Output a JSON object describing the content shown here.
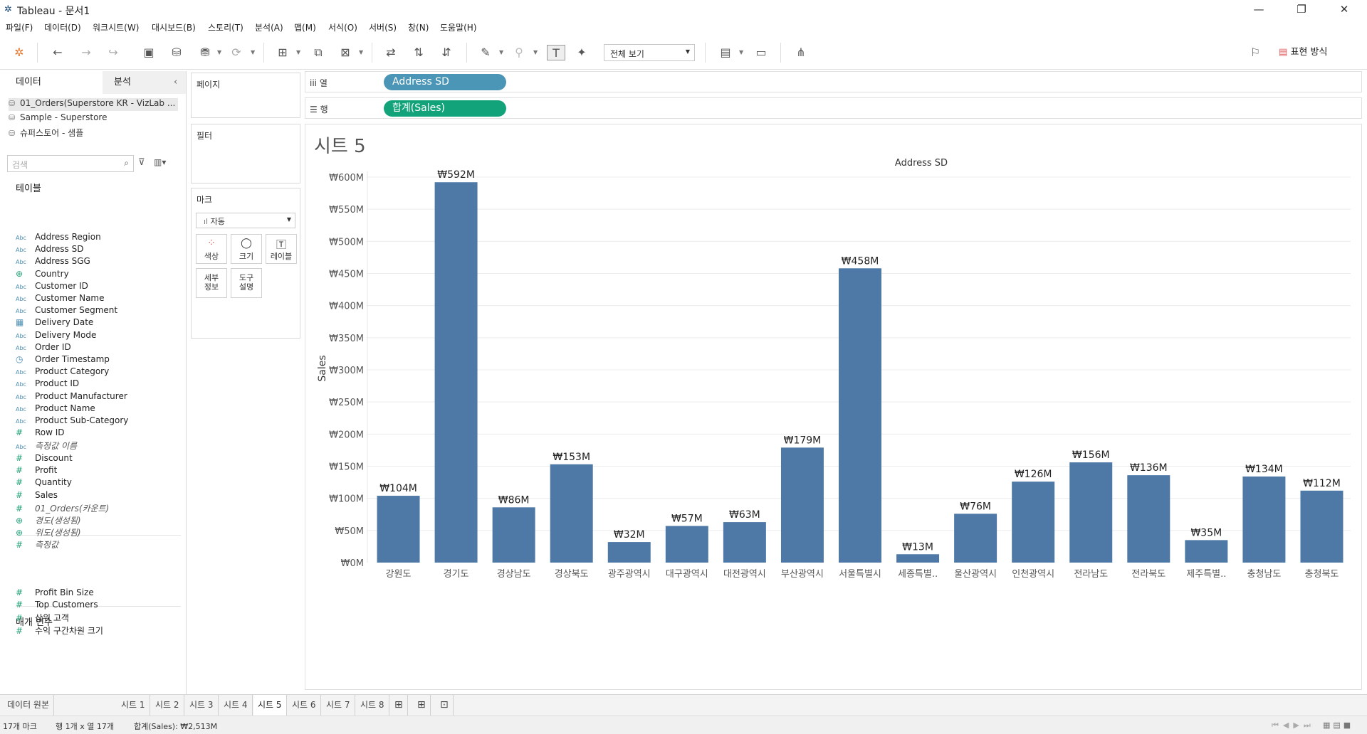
{
  "window": {
    "title": "Tableau - 문서1"
  },
  "menu": [
    "파일(F)",
    "데이터(D)",
    "워크시트(W)",
    "대시보드(B)",
    "스토리(T)",
    "분석(A)",
    "맵(M)",
    "서식(O)",
    "서버(S)",
    "창(N)",
    "도움말(H)"
  ],
  "toolbar": {
    "view_select": "전체 보기",
    "present_label": "표현 방식"
  },
  "left_pane": {
    "tabs": {
      "data": "데이터",
      "analysis": "분석"
    },
    "datasources": [
      "01_Orders(Superstore KR - VizLab ...",
      "Sample - Superstore",
      "슈퍼스토어 - 샘플"
    ],
    "search_placeholder": "검색",
    "tables_header": "테이블",
    "dimensions": [
      {
        "type": "Abc",
        "label": "Address Region"
      },
      {
        "type": "Abc",
        "label": "Address SD"
      },
      {
        "type": "Abc",
        "label": "Address SGG"
      },
      {
        "type": "geo",
        "label": "Country"
      },
      {
        "type": "Abc",
        "label": "Customer ID"
      },
      {
        "type": "Abc",
        "label": "Customer Name"
      },
      {
        "type": "Abc",
        "label": "Customer Segment"
      },
      {
        "type": "date",
        "label": "Delivery Date"
      },
      {
        "type": "Abc",
        "label": "Delivery Mode"
      },
      {
        "type": "Abc",
        "label": "Order ID"
      },
      {
        "type": "datetime",
        "label": "Order Timestamp"
      },
      {
        "type": "Abc",
        "label": "Product Category"
      },
      {
        "type": "Abc",
        "label": "Product ID"
      },
      {
        "type": "Abc",
        "label": "Product Manufacturer"
      },
      {
        "type": "Abc",
        "label": "Product Name"
      },
      {
        "type": "Abc",
        "label": "Product Sub-Category"
      },
      {
        "type": "num",
        "label": "Row ID"
      },
      {
        "type": "Abc",
        "label": "측정값 이름",
        "italic": true
      }
    ],
    "measures": [
      {
        "type": "num",
        "label": "Discount"
      },
      {
        "type": "num",
        "label": "Profit"
      },
      {
        "type": "num",
        "label": "Quantity"
      },
      {
        "type": "num",
        "label": "Sales"
      },
      {
        "type": "num",
        "label": "01_Orders(카운트)",
        "italic": true
      },
      {
        "type": "geo",
        "label": "경도(생성됨)",
        "italic": true
      },
      {
        "type": "geo",
        "label": "위도(생성됨)",
        "italic": true
      },
      {
        "type": "num",
        "label": "측정값",
        "italic": true
      }
    ],
    "parameters_header": "매개 변수",
    "parameters": [
      {
        "type": "num",
        "label": "Profit Bin Size"
      },
      {
        "type": "num",
        "label": "Top Customers"
      },
      {
        "type": "num",
        "label": "상위 고객"
      },
      {
        "type": "num",
        "label": "수익 구간차원 크기"
      }
    ]
  },
  "cards": {
    "pages": "페이지",
    "filters": "필터",
    "marks": "마크",
    "marks_type": "자동",
    "mark_buttons": {
      "color": "색상",
      "size": "크기",
      "label": "레이블",
      "detail": "세부\n정보",
      "tooltip": "도구\n설명"
    }
  },
  "shelves": {
    "columns_label": "열",
    "rows_label": "행",
    "columns_pill": "Address SD",
    "rows_pill": "합계(Sales)",
    "columns_color": "#4b96b7",
    "rows_color": "#12a37b"
  },
  "sheet_title": "시트 5",
  "chart_data": {
    "type": "bar",
    "title": "Address SD",
    "ylabel": "Sales",
    "xlabel": "",
    "ylim": [
      0,
      600
    ],
    "y_ticks": [
      0,
      50,
      100,
      150,
      200,
      250,
      300,
      350,
      400,
      450,
      500,
      550,
      600
    ],
    "y_tick_labels": [
      "₩0M",
      "₩50M",
      "₩100M",
      "₩150M",
      "₩200M",
      "₩250M",
      "₩300M",
      "₩350M",
      "₩400M",
      "₩450M",
      "₩500M",
      "₩550M",
      "₩600M"
    ],
    "categories": [
      "강원도",
      "경기도",
      "경상남도",
      "경상북도",
      "광주광역시",
      "대구광역시",
      "대전광역시",
      "부산광역시",
      "서울특별시",
      "세종특별..",
      "울산광역시",
      "인천광역시",
      "전라남도",
      "전라북도",
      "제주특별..",
      "충청남도",
      "충청북도"
    ],
    "values": [
      104,
      592,
      86,
      153,
      32,
      57,
      63,
      179,
      458,
      13,
      76,
      126,
      156,
      136,
      35,
      134,
      112
    ],
    "data_labels": [
      "₩104M",
      "₩592M",
      "₩86M",
      "₩153M",
      "₩32M",
      "₩57M",
      "₩63M",
      "₩179M",
      "₩458M",
      "₩13M",
      "₩76M",
      "₩126M",
      "₩156M",
      "₩136M",
      "₩35M",
      "₩134M",
      "₩112M"
    ],
    "bar_color": "#4e79a7",
    "grid": true
  },
  "sheet_tabs": [
    "데이터 원본",
    "시트 1",
    "시트 2",
    "시트 3",
    "시트 4",
    "시트 5",
    "시트 6",
    "시트 7",
    "시트 8"
  ],
  "active_sheet": "시트 5",
  "status": {
    "marks": "17개 마크",
    "rowscols": "행 1개 x 열 17개",
    "sum": "합계(Sales): ₩2,513M"
  }
}
